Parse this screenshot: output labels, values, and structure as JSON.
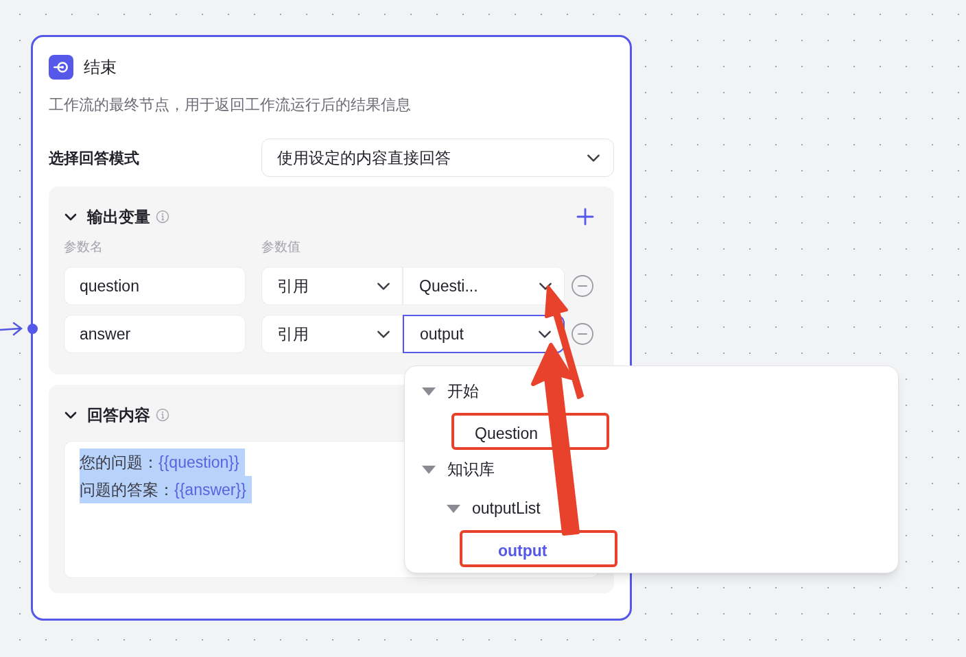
{
  "node": {
    "title": "结束",
    "description": "工作流的最终节点，用于返回工作流运行后的结果信息",
    "mode": {
      "label": "选择回答模式",
      "value": "使用设定的内容直接回答"
    },
    "output_variables": {
      "title": "输出变量",
      "expanded": true,
      "columns": [
        "参数名",
        "参数值"
      ],
      "rows": [
        {
          "name": "question",
          "source": "引用",
          "value": "Questi...",
          "focused": false
        },
        {
          "name": "answer",
          "source": "引用",
          "value": "output",
          "focused": true
        }
      ]
    },
    "answer_content": {
      "title": "回答内容",
      "expanded": true,
      "lines": [
        {
          "text": "您的问题：",
          "variable": "{{question}}"
        },
        {
          "text": "问题的答案：",
          "variable": "{{answer}}"
        }
      ]
    }
  },
  "dropdown": {
    "tree": [
      {
        "label": "开始",
        "expanded": true,
        "children": [
          {
            "label": "Question",
            "selected": false,
            "annotated": true
          }
        ]
      },
      {
        "label": "知识库",
        "expanded": true,
        "children": [
          {
            "label": "outputList",
            "expanded": true,
            "children": [
              {
                "label": "output",
                "selected": true,
                "annotated": true
              }
            ]
          }
        ]
      }
    ]
  }
}
